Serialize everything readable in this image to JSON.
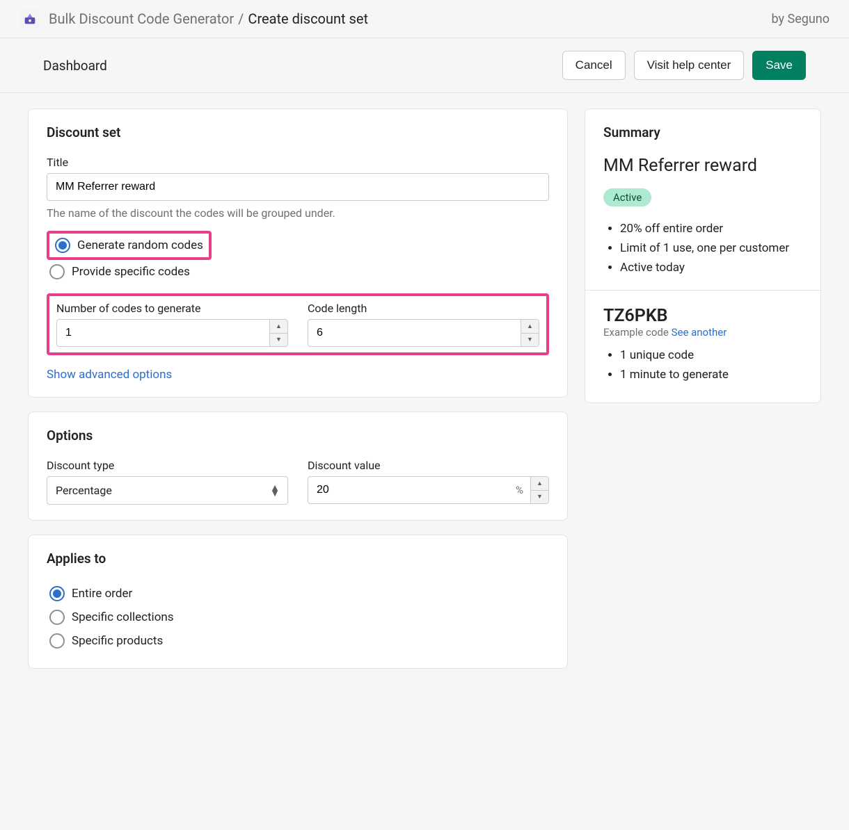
{
  "header": {
    "app_name": "Bulk Discount Code Generator",
    "separator": "/",
    "page": "Create discount set",
    "byline": "by Seguno"
  },
  "subheader": {
    "title": "Dashboard",
    "cancel": "Cancel",
    "help": "Visit help center",
    "save": "Save"
  },
  "discount_set": {
    "heading": "Discount set",
    "title_label": "Title",
    "title_value": "MM Referrer reward",
    "title_helper": "The name of the discount the codes will be grouped under.",
    "radio_generate": "Generate random codes",
    "radio_provide": "Provide specific codes",
    "num_codes_label": "Number of codes to generate",
    "num_codes_value": "1",
    "code_length_label": "Code length",
    "code_length_value": "6",
    "advanced_link": "Show advanced options"
  },
  "options": {
    "heading": "Options",
    "type_label": "Discount type",
    "type_value": "Percentage",
    "value_label": "Discount value",
    "value_value": "20",
    "value_suffix": "%"
  },
  "applies": {
    "heading": "Applies to",
    "opt_entire": "Entire order",
    "opt_collections": "Specific collections",
    "opt_products": "Specific products"
  },
  "summary": {
    "heading": "Summary",
    "title": "MM Referrer reward",
    "badge": "Active",
    "bullets": [
      "20% off entire order",
      "Limit of 1 use, one per customer",
      "Active today"
    ],
    "example_code": "TZ6PKB",
    "example_label": "Example code ",
    "see_another": "See another",
    "detail_bullets": [
      "1 unique code",
      "1 minute to generate"
    ]
  }
}
